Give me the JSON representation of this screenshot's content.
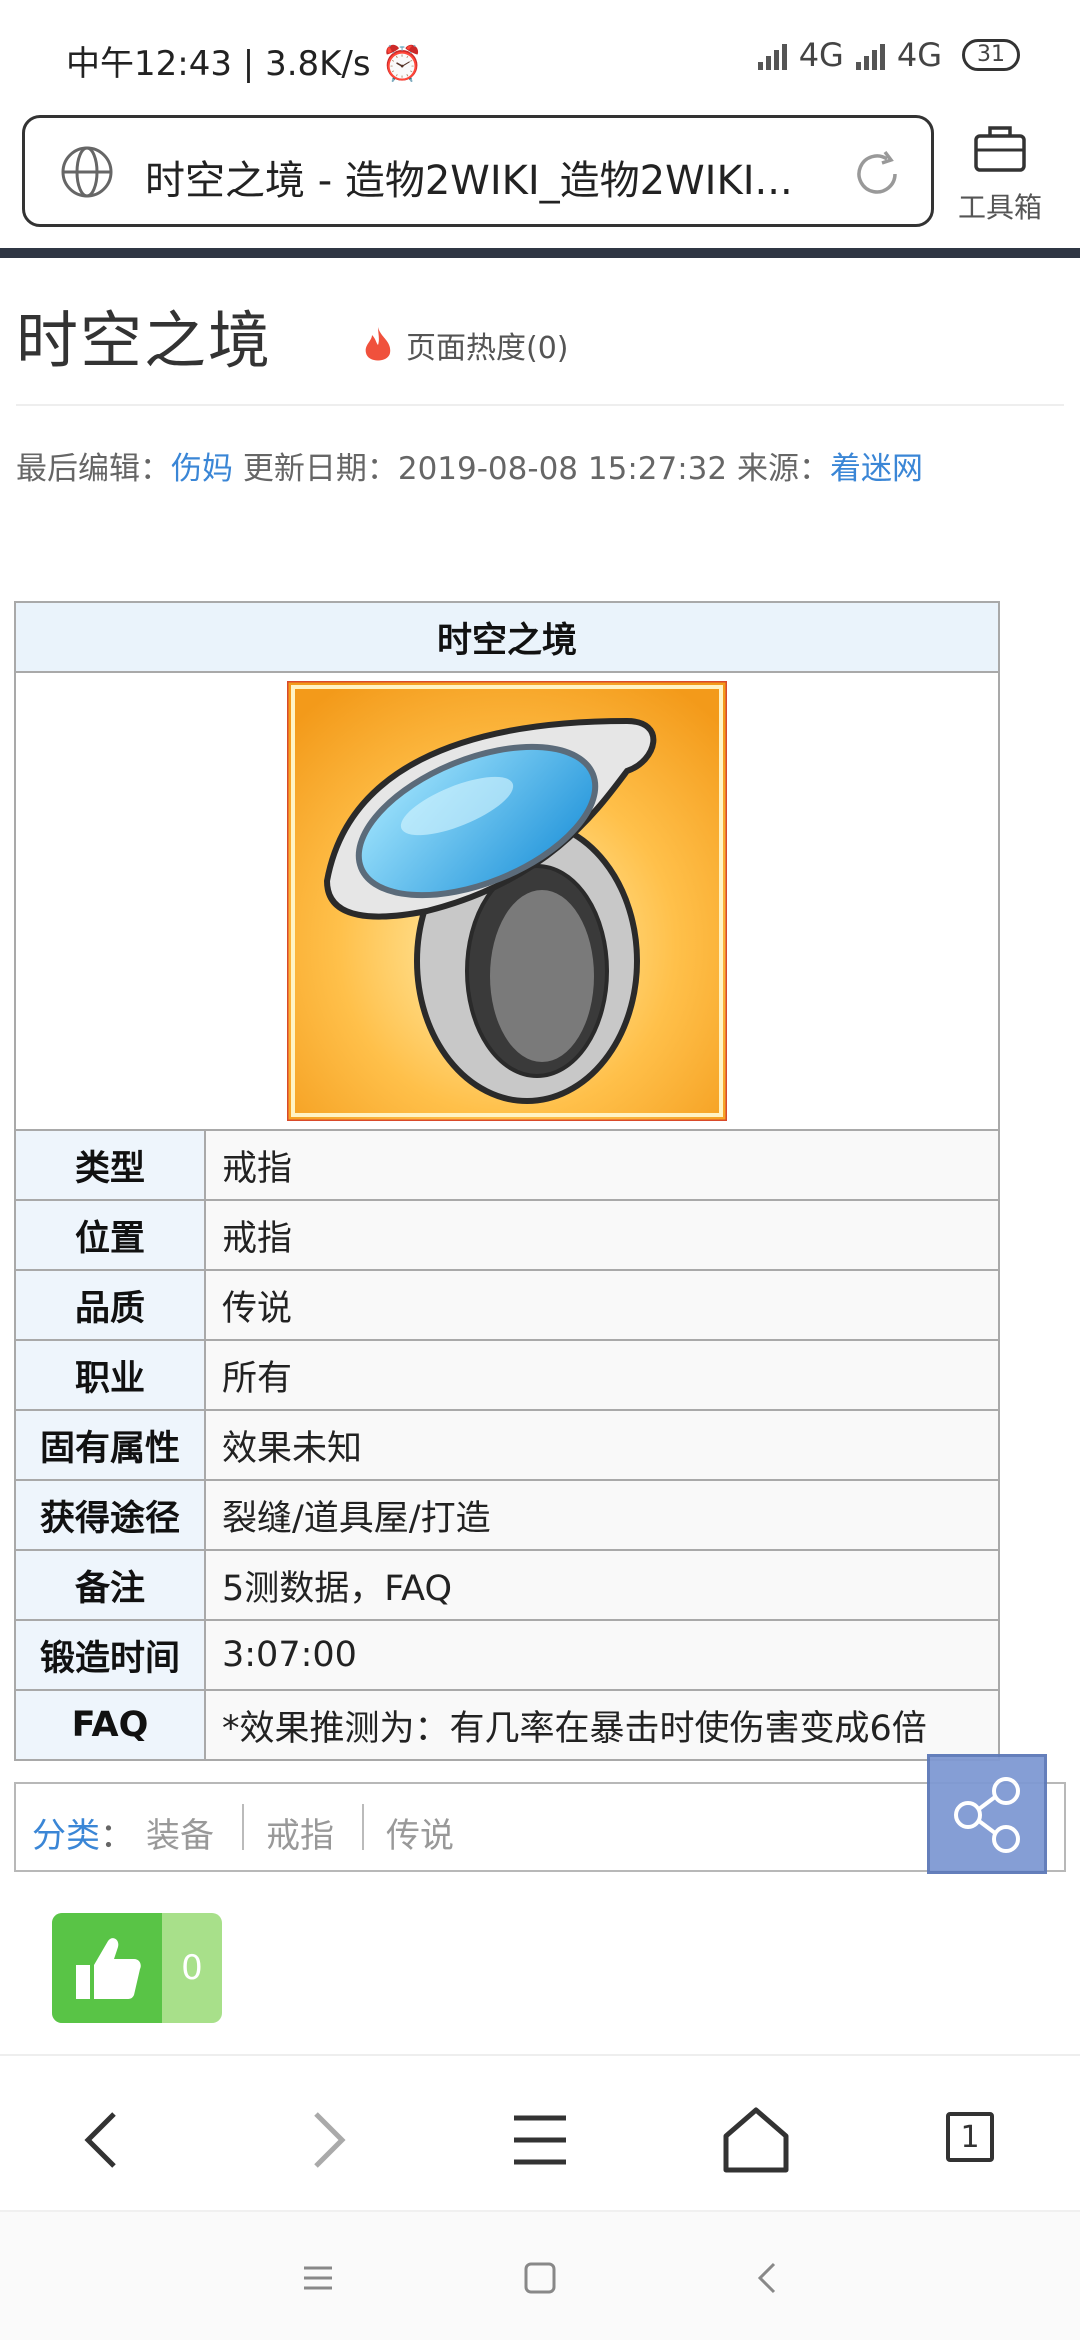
{
  "status": {
    "time": "中午12:43",
    "speed": "3.8K/s",
    "net1": "4G",
    "net2": "4G",
    "battery": "31"
  },
  "browser": {
    "url_title": "时空之境 - 造物2WIKI_造物2WIKI...",
    "toolbox_label": "工具箱"
  },
  "page": {
    "title": "时空之境",
    "heat": "页面热度(0)",
    "meta_editor_label": "最后编辑：",
    "meta_editor": "伤妈",
    "meta_date": "更新日期：2019-08-08 15:27:32",
    "meta_source_label": "来源：",
    "meta_source": "着迷网"
  },
  "infobox": {
    "title": "时空之境",
    "rows": [
      {
        "key": "类型",
        "value": "戒指"
      },
      {
        "key": "位置",
        "value": "戒指"
      },
      {
        "key": "品质",
        "value": "传说"
      },
      {
        "key": "职业",
        "value": "所有"
      },
      {
        "key": "固有属性",
        "value": "效果未知"
      },
      {
        "key": "获得途径",
        "value": "裂缝/道具屋/打造"
      },
      {
        "key": "备注",
        "value": "5测数据，FAQ"
      },
      {
        "key": "锻造时间",
        "value": "3:07:00"
      },
      {
        "key": "FAQ",
        "value": "*效果推测为：有几率在暴击时使伤害变成6倍"
      }
    ]
  },
  "categories": {
    "label": "分类",
    "colon": "：",
    "items": [
      "装备",
      "戒指",
      "传说"
    ]
  },
  "like": {
    "count": "0"
  },
  "tabs_count": "1",
  "icons": {
    "share": "share-icon",
    "like": "thumbs-up-icon",
    "back": "chevron-left-icon",
    "forward": "chevron-right-icon",
    "menu": "hamburger-icon",
    "home": "home-icon",
    "tabs": "tabs-icon"
  },
  "colors": {
    "link": "#3a86d6",
    "like_green": "#59c446",
    "share_blue": "#7f99d3",
    "infobox_header_bg": "#eaf3fb"
  }
}
